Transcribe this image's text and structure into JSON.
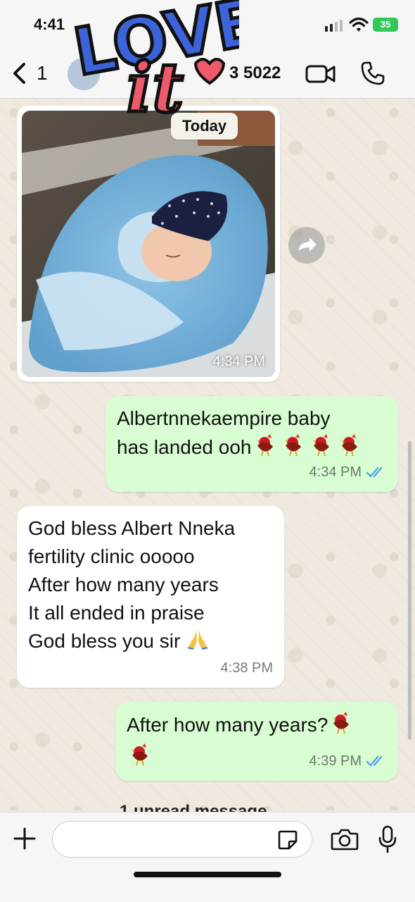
{
  "status": {
    "time": "4:41",
    "battery": "35"
  },
  "header": {
    "back_count": "1",
    "contact_partial": "3 5022"
  },
  "sticker": {
    "line1": "LOVE",
    "line2": "it"
  },
  "day_chip": "Today",
  "messages": [
    {
      "type": "image",
      "direction": "in",
      "time": "4:34 PM"
    },
    {
      "type": "text",
      "direction": "out",
      "lines": [
        "Albertnnekaempire baby",
        "has landed ooh"
      ],
      "time": "4:34 PM"
    },
    {
      "type": "text",
      "direction": "in",
      "lines": [
        "God bless Albert Nneka",
        "fertility clinic ooooo",
        "After how many years",
        "It all ended in praise",
        "God bless you sir"
      ],
      "time": "4:38 PM"
    },
    {
      "type": "text",
      "direction": "out",
      "lines": [
        "After how many years?"
      ],
      "time": "4:39 PM"
    }
  ],
  "unread_label": "1 unread message",
  "composer": {
    "placeholder": ""
  },
  "colors": {
    "outgoing": "#d9fdd3",
    "incoming": "#ffffff",
    "read_ticks": "#53a6e6",
    "battery": "#34c759"
  }
}
